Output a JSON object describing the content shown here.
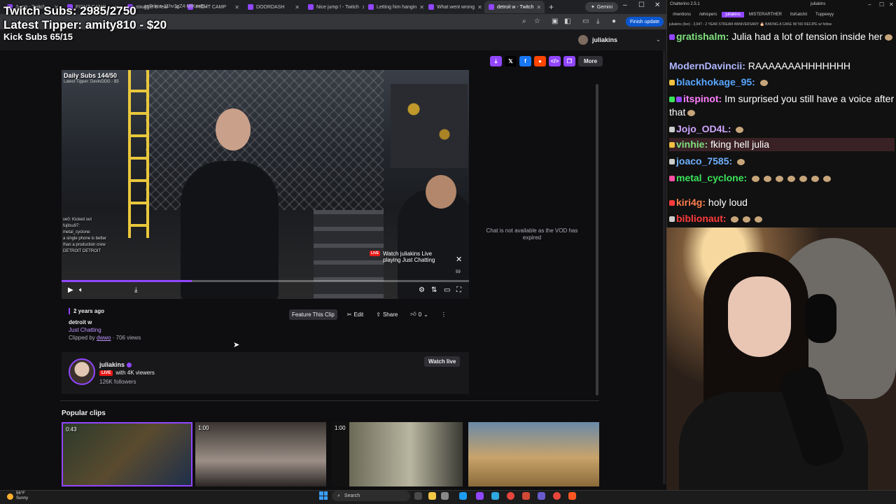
{
  "browser": {
    "tabs": [
      {
        "label": "Jump - Twitch",
        "active": false
      },
      {
        "label": "FIGHT CAMP",
        "active": false
      },
      {
        "label": "struggle is real",
        "active": false
      },
      {
        "label": "FIGHT CAMP",
        "active": false
      },
      {
        "label": "DOORDASH",
        "active": false
      },
      {
        "label": "Nice jump ! - Twitch",
        "active": false
      },
      {
        "label": "Letting him hangin",
        "active": false
      },
      {
        "label": "What went wrong",
        "active": false
      },
      {
        "label": "detroit w - Twitch",
        "active": true
      }
    ],
    "url": "...zePrime-11hv3gZ4-MfKrwEU",
    "gemini_label": "Gemini",
    "finish_update_label": "Finish update"
  },
  "overlay": {
    "twitch_subs": "Twitch Subs: 2985/2750",
    "latest_tipper": "Latest Tipper: amity810 - $20",
    "kick_subs": "Kick Subs 65/15"
  },
  "header": {
    "channel_name": "juliakins"
  },
  "share_bar": {
    "more_label": "More"
  },
  "video": {
    "daily_subs": "Daily Subs 144/50",
    "latest_tipper": "Latest Tipper: DevinDDG - $5",
    "watch_live_tag": "LIVE",
    "watch_live_title": "Watch juliakins Live",
    "watch_live_subtitle": "playing Just Chatting",
    "countdown": "59",
    "progress": 0.32,
    "overlay_chat": [
      "ve0: Kicked out",
      "fujitsu97:",
      "metal_cyclone:",
      "a single phone is better",
      "than a production crew",
      "DETROIT DETROIT"
    ]
  },
  "clip": {
    "age": "2 years ago",
    "title": "detroit w",
    "category": "Just Chatting",
    "clipped_by_prefix": "Clipped by",
    "clipper": "dwwo",
    "views": "· 706 views",
    "feature_label": "Feature This Clip",
    "edit_label": "Edit",
    "share_label": "Share",
    "likes": "0"
  },
  "streamer": {
    "name": "juliakins",
    "live_tag": "LIVE",
    "viewers": "with 4K viewers",
    "followers": "126K followers",
    "watch_live_label": "Watch live"
  },
  "chat_panel": {
    "unavailable": "Chat is not available as the VOD has expired"
  },
  "popular": {
    "title": "Popular clips",
    "clips": [
      {
        "duration": "0:43"
      },
      {
        "duration": "1:00"
      },
      {
        "duration": "1:00"
      },
      {
        "duration": ""
      }
    ]
  },
  "chatterino": {
    "title": "Chatterino 2.5.1",
    "user": "juliakins",
    "tabs": [
      "/mentions",
      "/whispers",
      "juliakins",
      "MISTERARTHER",
      "itsKatchii",
      "Tuppeeyy"
    ],
    "stream_title": "juliakins (live) - 3,947 - 2 YEAR STREAM ANNIVERSARY 🎂 BAKING A CAKE W/ NO RECIPE w/ follow",
    "messages": [
      {
        "user": "gratishalm:",
        "text": "Julia had a lot of tension inside her",
        "color": "#7fe17f",
        "highlight": false
      },
      {
        "user": "ModernDavincii:",
        "text": "RAAAAAAAHHHHHHH",
        "color": "#b0b7ff",
        "highlight": false
      },
      {
        "user": "blackhokage_95:",
        "text": "",
        "color": "#58a6ff",
        "highlight": false
      },
      {
        "user": "itspinot:",
        "text": "Im surprised you still have a voice after that",
        "color": "#ff80ff",
        "highlight": false
      },
      {
        "user": "Jojo_OD4L:",
        "text": "",
        "color": "#cfa6ff",
        "highlight": false
      },
      {
        "user": "vinhie:",
        "text": "fking hell julia",
        "color": "#7fe17f",
        "highlight": true
      },
      {
        "user": "joaco_7585:",
        "text": "",
        "color": "#6fb0ff",
        "highlight": false
      },
      {
        "user": "metal_cyclone:",
        "text": "",
        "color": "#3ae35a",
        "highlight": false
      },
      {
        "user": "kiri4g:",
        "text": "holy loud",
        "color": "#ff7f50",
        "highlight": false
      },
      {
        "user": "biblionaut:",
        "text": "",
        "color": "#ff3b3b",
        "highlight": false
      }
    ]
  },
  "taskbar": {
    "weather_temp": "56°F",
    "weather_desc": "Sunny",
    "search_label": "Search"
  },
  "colors": {
    "twitch_purple": "#9146ff",
    "live_red": "#e91916",
    "background": "#0e0e10"
  }
}
